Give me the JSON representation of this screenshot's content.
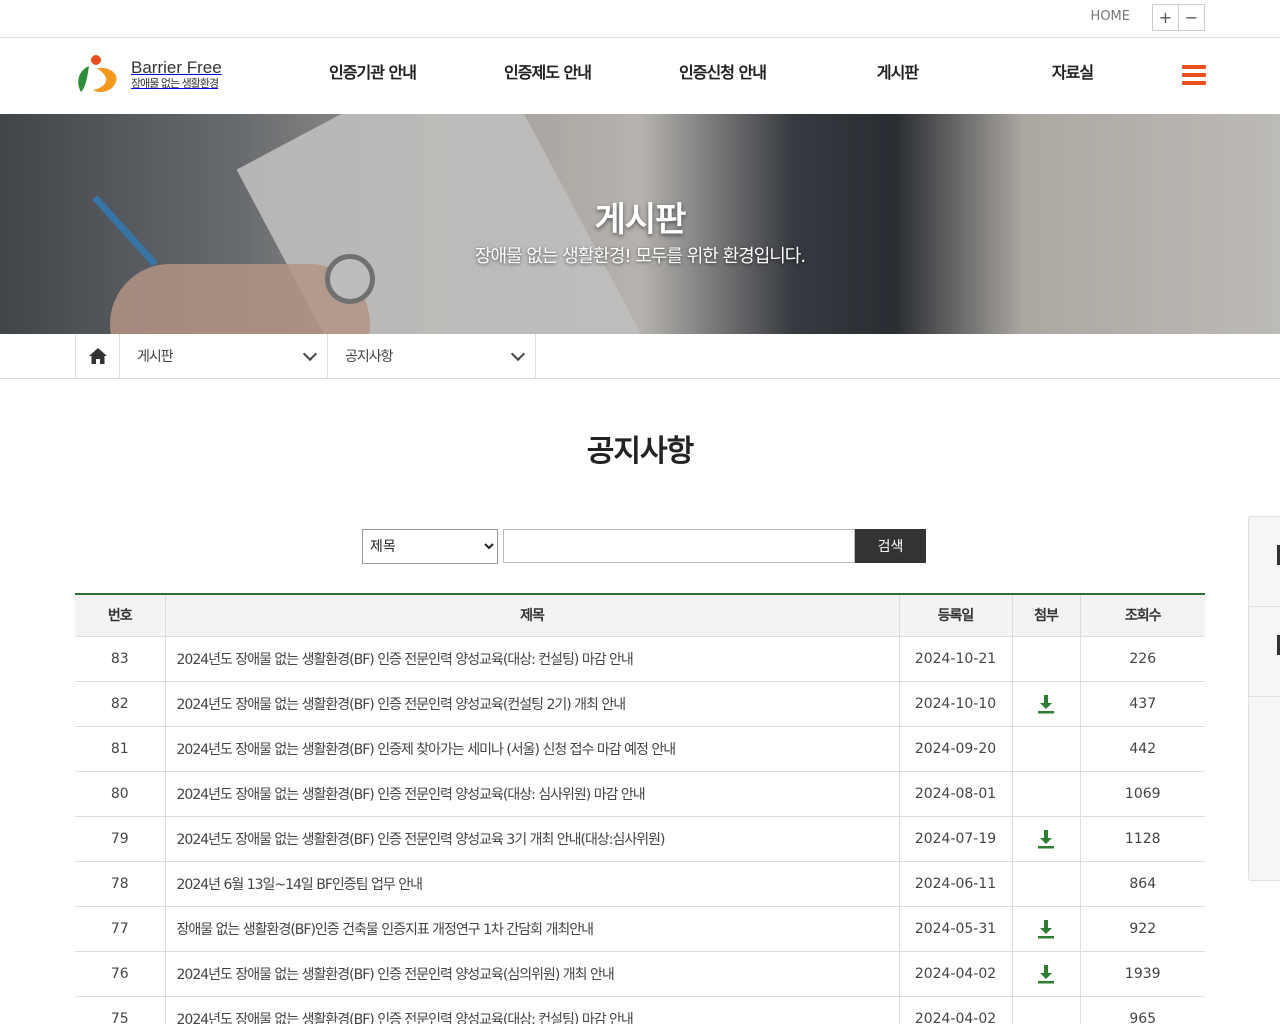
{
  "util": {
    "home": "HOME",
    "zoom_in": "+",
    "zoom_out": "−"
  },
  "logo": {
    "title": "Barrier Free",
    "subtitle": "장애물 없는 생활환경"
  },
  "gnb": [
    "인증기관 안내",
    "인증제도 안내",
    "인증신청 안내",
    "게시판",
    "자료실"
  ],
  "hero": {
    "title": "게시판",
    "subtitle": "장애물 없는 생활환경! 모두를 위한 환경입니다."
  },
  "location": {
    "depth1": "게시판",
    "depth2": "공지사항"
  },
  "page_title": "공지사항",
  "search": {
    "selected": "제목",
    "value": "",
    "button": "검색"
  },
  "table": {
    "headers": [
      "번호",
      "제목",
      "등록일",
      "첨부",
      "조회수"
    ],
    "rows": [
      {
        "no": "83",
        "title": "2024년도 장애물 없는 생활환경(BF) 인증 전문인력 양성교육(대상: 컨설팅) 마감 안내",
        "date": "2024-10-21",
        "attach": false,
        "views": "226"
      },
      {
        "no": "82",
        "title": "2024년도 장애물 없는 생활환경(BF) 인증 전문인력 양성교육(컨설팅 2기) 개최 안내",
        "date": "2024-10-10",
        "attach": true,
        "views": "437"
      },
      {
        "no": "81",
        "title": "2024년도 장애물 없는 생활환경(BF) 인증제 찾아가는 세미나 (서울) 신청 접수 마감 예정 안내",
        "date": "2024-09-20",
        "attach": false,
        "views": "442"
      },
      {
        "no": "80",
        "title": "2024년도 장애물 없는 생활환경(BF) 인증 전문인력 양성교육(대상: 심사위원) 마감 안내",
        "date": "2024-08-01",
        "attach": false,
        "views": "1069"
      },
      {
        "no": "79",
        "title": "2024년도 장애물 없는 생활환경(BF) 인증 전문인력 양성교육 3기 개최 안내(대상:심사위원)",
        "date": "2024-07-19",
        "attach": true,
        "views": "1128"
      },
      {
        "no": "78",
        "title": "2024년 6월 13일~14일 BF인증팀 업무 안내",
        "date": "2024-06-11",
        "attach": false,
        "views": "864"
      },
      {
        "no": "77",
        "title": "장애물 없는 생활환경(BF)인증 건축물 인증지표 개정연구 1차 간담회 개최안내",
        "date": "2024-05-31",
        "attach": true,
        "views": "922"
      },
      {
        "no": "76",
        "title": "2024년도 장애물 없는 생활환경(BF) 인증 전문인력 양성교육(심의위원) 개최 안내",
        "date": "2024-04-02",
        "attach": true,
        "views": "1939"
      },
      {
        "no": "75",
        "title": "2024년도 장애물 없는 생활환경(BF) 인증 전문인력 양성교육(대상: 컨설팅) 마감 안내",
        "date": "2024-04-02",
        "attach": false,
        "views": "965"
      }
    ]
  },
  "colors": {
    "accent": "#e8501f",
    "table_top": "#2f6d3a",
    "download": "#2f7d33"
  },
  "icons": {
    "home": "home-icon",
    "menu": "hamburger-menu-icon",
    "download": "download-icon",
    "chevron": "chevron-down-icon"
  }
}
